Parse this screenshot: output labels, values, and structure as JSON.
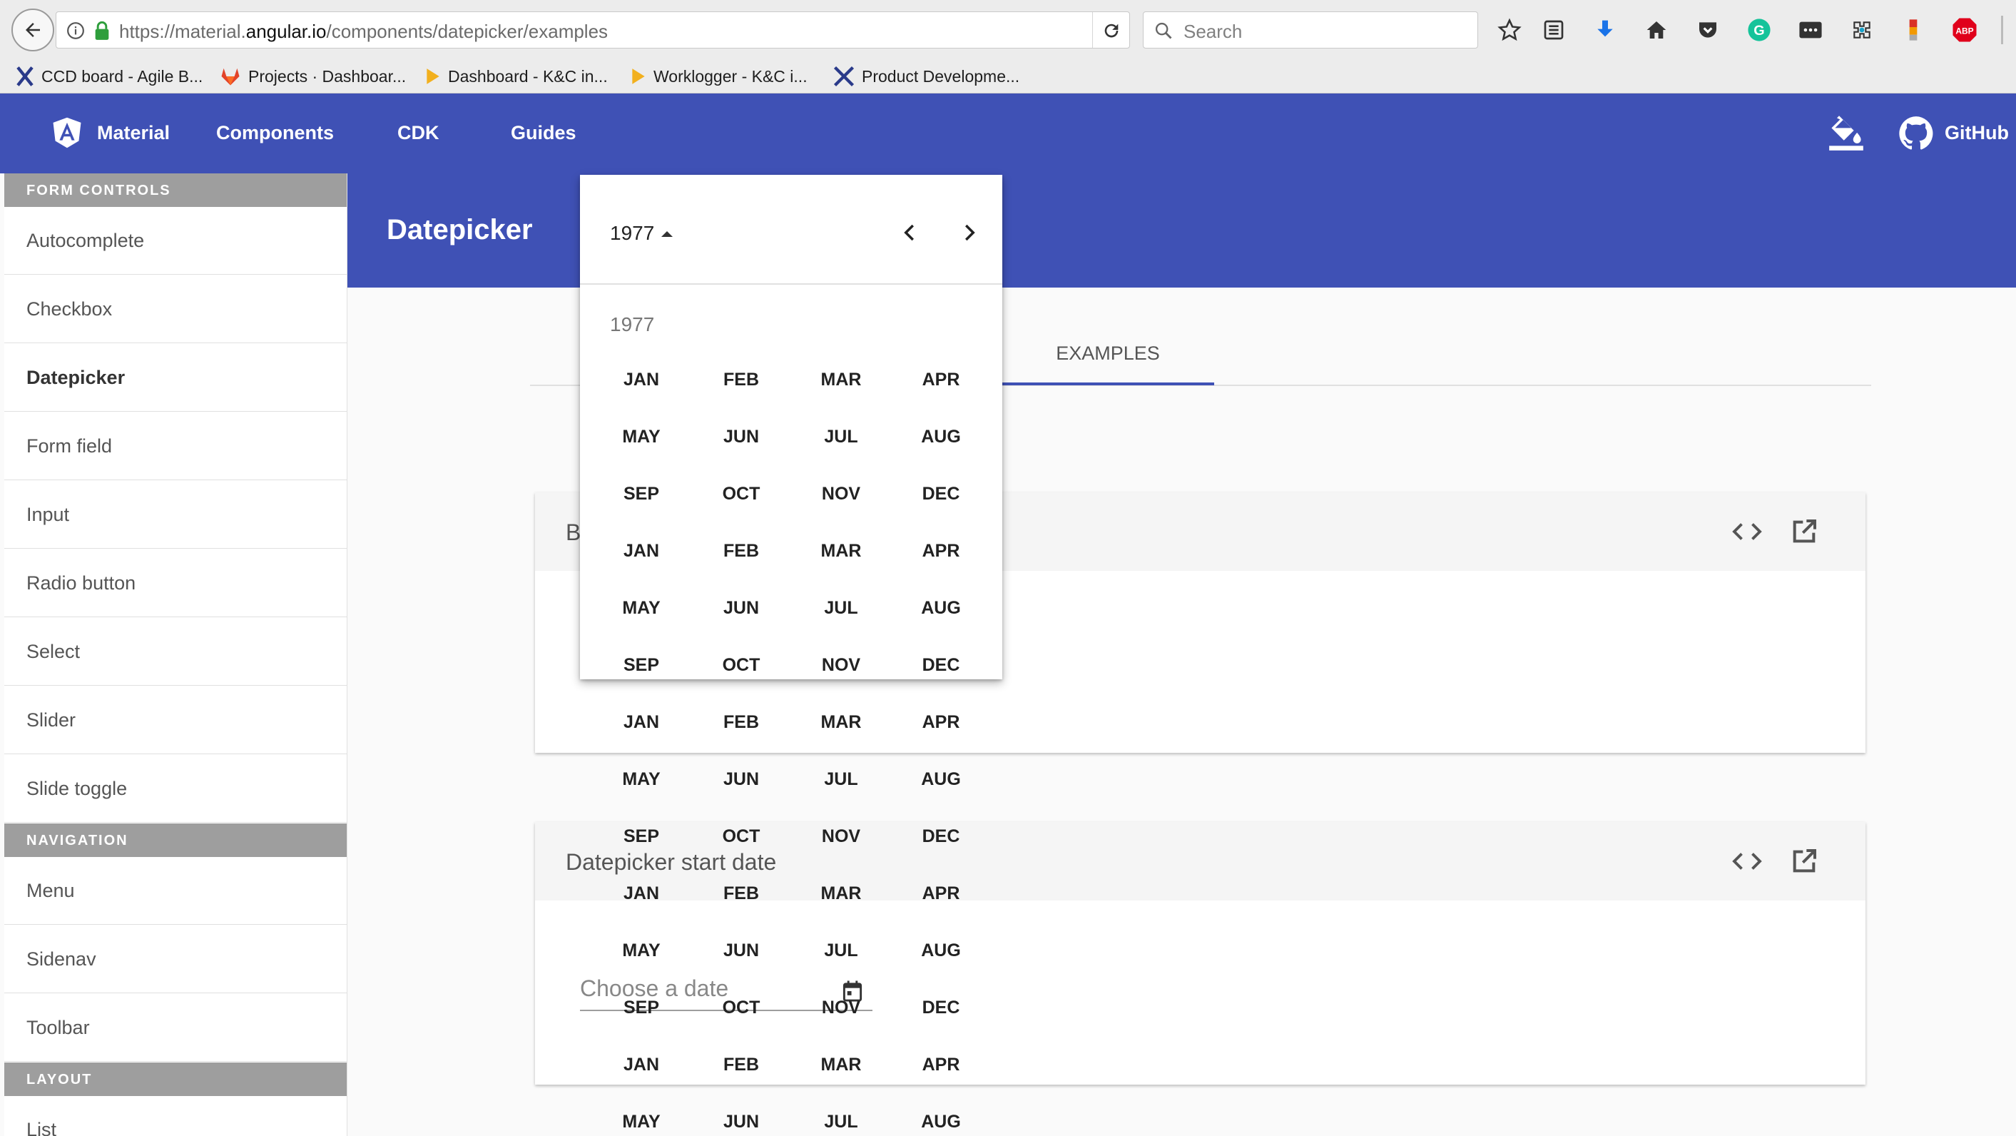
{
  "browser": {
    "url_prefix": "https://material.",
    "url_domain": "angular.io",
    "url_path": "/components/datepicker/examples",
    "search_placeholder": "Search",
    "bookmarks": [
      {
        "label": "CCD board - Agile B..."
      },
      {
        "label": "Projects · Dashboar..."
      },
      {
        "label": "Dashboard - K&C in..."
      },
      {
        "label": "Worklogger - K&C i..."
      },
      {
        "label": "Product Developme..."
      }
    ],
    "extension_badge": "ABP"
  },
  "header": {
    "brand": "Material",
    "nav": [
      "Components",
      "CDK",
      "Guides"
    ],
    "github": "GitHub"
  },
  "sidebar": {
    "sections": [
      {
        "heading": "FORM CONTROLS",
        "items": [
          "Autocomplete",
          "Checkbox",
          "Datepicker",
          "Form field",
          "Input",
          "Radio button",
          "Select",
          "Slider",
          "Slide toggle"
        ]
      },
      {
        "heading": "NAVIGATION",
        "items": [
          "Menu",
          "Sidenav",
          "Toolbar"
        ]
      },
      {
        "heading": "LAYOUT",
        "items": [
          "List"
        ]
      }
    ],
    "active_item": "Datepicker"
  },
  "page": {
    "title": "Datepicker",
    "tab_active": "EXAMPLES",
    "cards": [
      {
        "title": "B"
      },
      {
        "title": "Datepicker start date",
        "input_placeholder": "Choose a date"
      }
    ]
  },
  "datepicker": {
    "period_label": "1977",
    "year_label": "1977",
    "months": [
      "JAN",
      "FEB",
      "MAR",
      "APR",
      "MAY",
      "JUN",
      "JUL",
      "AUG",
      "SEP",
      "OCT",
      "NOV",
      "DEC"
    ]
  },
  "colors": {
    "primary": "#3f51b5",
    "sidebar_heading_bg": "#9e9e9e",
    "card_head_bg": "#f5f5f5"
  }
}
